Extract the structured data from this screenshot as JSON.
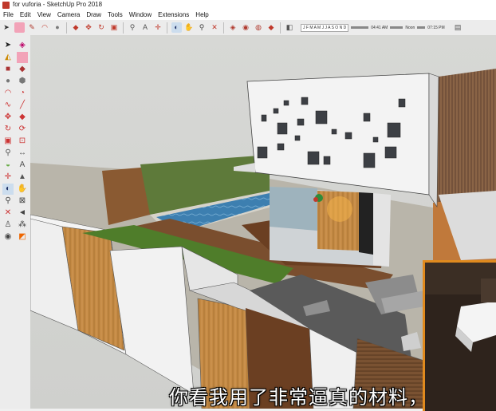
{
  "window": {
    "title": "for vuforia - SketchUp Pro 2018"
  },
  "menu": [
    "File",
    "Edit",
    "View",
    "Camera",
    "Draw",
    "Tools",
    "Window",
    "Extensions",
    "Help"
  ],
  "toolbar": {
    "icons": [
      "select-icon",
      "eraser-icon",
      "pencil-icon",
      "arc-icon",
      "circle-icon",
      "push-pull-icon",
      "move-icon",
      "rotate-icon",
      "offset-icon",
      "tape-measure-icon",
      "text-icon",
      "axes-icon",
      "orbit-icon",
      "pan-icon",
      "zoom-extents-icon",
      "warehouse-icon",
      "extension-icon",
      "component-icon",
      "ruby-icon",
      "section-icon"
    ],
    "shadow_months": "J F M A M J J A S O N D",
    "time_start": "04:41 AM",
    "time_noon": "Noon",
    "time_end": "07:15 PM"
  },
  "left_tools": [
    "select-icon",
    "eraser-icon",
    "paint-bucket-icon",
    "eraser-alt-icon",
    "rectangle-icon",
    "rotated-rectangle-icon",
    "circle-icon",
    "polygon-icon",
    "arc-icon",
    "pie-icon",
    "freehand-icon",
    "line-icon",
    "move-icon",
    "push-pull-icon",
    "rotate-icon",
    "follow-me-icon",
    "scale-icon",
    "offset-icon",
    "tape-measure-icon",
    "dimension-icon",
    "protractor-icon",
    "text-icon",
    "axes-icon",
    "3d-text-icon",
    "orbit-icon",
    "pan-icon",
    "zoom-icon",
    "zoom-window-icon",
    "zoom-extents-icon",
    "previous-view-icon",
    "position-camera-icon",
    "walk-icon",
    "look-around-icon",
    "section-plane-icon"
  ],
  "subtitle": "你看我用了非常逼真的材料，",
  "colors": {
    "accent": "#e08a1e",
    "grass": "#4f7d2a",
    "water": "#3d7fb0",
    "wood": "#c48a44"
  }
}
